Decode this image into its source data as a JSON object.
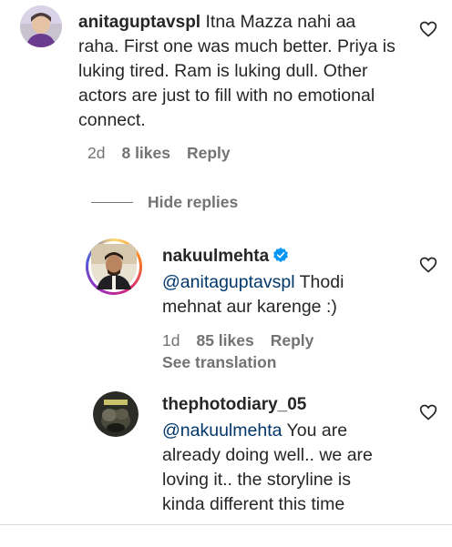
{
  "comments": [
    {
      "username": "anitaguptavspl",
      "text": "Itna Mazza nahi aa raha. First one was much better. Priya is luking tired. Ram is luking dull. Other actors are just to fill with no emotional connect.",
      "time": "2d",
      "likes": "8 likes",
      "reply_label": "Reply"
    }
  ],
  "replies_toggle": "Hide replies",
  "replies": [
    {
      "username": "nakuulmehta",
      "verified": true,
      "mention": "@anitaguptavspl",
      "text_line1": " Thodi",
      "text_line2": "mehnat aur karenge :)",
      "time": "1d",
      "likes": "85 likes",
      "reply_label": "Reply",
      "translation": "See translation"
    },
    {
      "username": "thephotodiary_05",
      "mention": "@nakuulmehta",
      "text_line1": " You are",
      "text_line2": "already doing well.. we are",
      "text_line3": "loving it.. the storyline is",
      "text_line4": "kinda different this time"
    }
  ],
  "colors": {
    "text": "#262626",
    "secondary": "#737373",
    "mention": "#00376b",
    "verified": "#0095f6"
  },
  "icons": [
    "heart-icon",
    "verified-badge-icon"
  ]
}
